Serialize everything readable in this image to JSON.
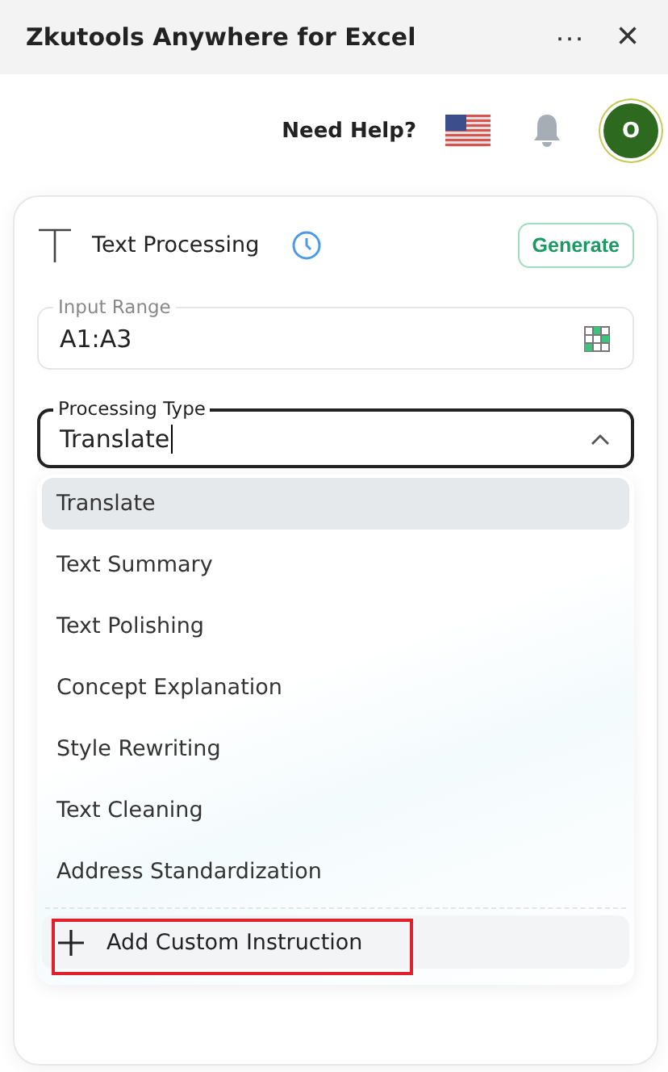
{
  "window": {
    "title": "Zkutools Anywhere for Excel",
    "more": "···",
    "close": "×"
  },
  "help_bar": {
    "label": "Need Help?",
    "avatar": "O"
  },
  "card": {
    "title": "Text Processing",
    "generate": "Generate",
    "input_range": {
      "label": "Input Range",
      "value": "A1:A3"
    },
    "processing_type": {
      "label": "Processing Type",
      "value": "Translate",
      "expanded": true
    },
    "options": [
      {
        "label": "Translate",
        "selected": true
      },
      {
        "label": "Text Summary",
        "selected": false
      },
      {
        "label": "Text Polishing",
        "selected": false
      },
      {
        "label": "Concept Explanation",
        "selected": false
      },
      {
        "label": "Style Rewriting",
        "selected": false
      },
      {
        "label": "Text Cleaning",
        "selected": false
      },
      {
        "label": "Address Standardization",
        "selected": false
      }
    ],
    "add_custom": {
      "label": "Add Custom Instruction",
      "highlighted": true
    }
  }
}
